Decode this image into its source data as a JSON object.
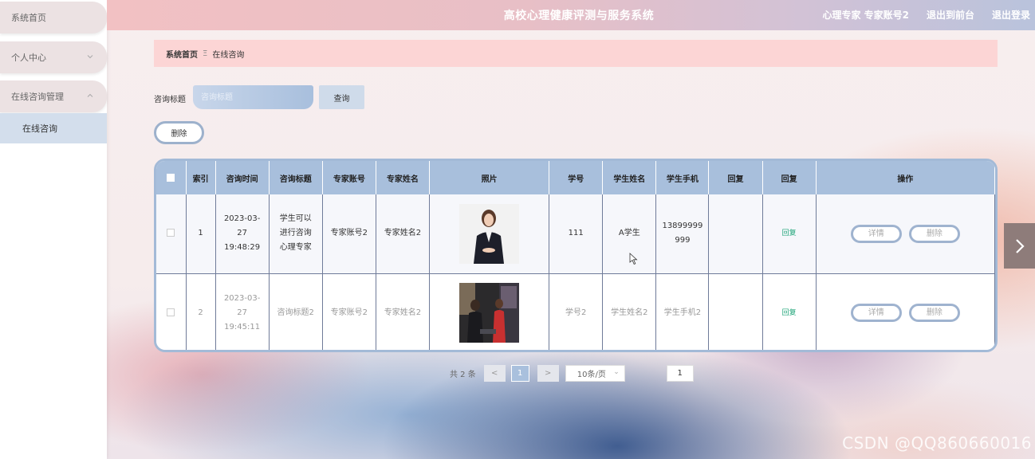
{
  "header": {
    "title": "高校心理健康评测与服务系统",
    "user": "心理专家 专家账号2",
    "back_to_front": "退出到前台",
    "logout": "退出登录"
  },
  "sidebar": {
    "items": [
      {
        "label": "系统首页"
      },
      {
        "label": "个人中心"
      },
      {
        "label": "在线咨询管理"
      }
    ],
    "sub_item": "在线咨询"
  },
  "breadcrumb": {
    "home": "系统首页",
    "separator": "Ξ",
    "current": "在线咨询"
  },
  "search": {
    "label": "咨询标题",
    "placeholder": "咨询标题",
    "button": "查询"
  },
  "actions": {
    "delete": "删除"
  },
  "table": {
    "headers": [
      "索引",
      "咨询时间",
      "咨询标题",
      "专家账号",
      "专家姓名",
      "照片",
      "学号",
      "学生姓名",
      "学生手机",
      "回复",
      "回复",
      "操作"
    ],
    "rows": [
      {
        "index": "1",
        "time": "2023-03-27 19:48:29",
        "title": "学生可以进行咨询心理专家",
        "expert_account": "专家账号2",
        "expert_name": "专家姓名2",
        "student_id": "111",
        "student_name": "A学生",
        "student_phone": "13899999999",
        "reply_text": "",
        "reply_link": "回复",
        "detail": "详情",
        "delete": "删除"
      },
      {
        "index": "2",
        "time": "2023-03-27 19:45:11",
        "title": "咨询标题2",
        "expert_account": "专家账号2",
        "expert_name": "专家姓名2",
        "student_id": "学号2",
        "student_name": "学生姓名2",
        "student_phone": "学生手机2",
        "reply_text": "",
        "reply_link": "回复",
        "detail": "详情",
        "delete": "删除"
      }
    ]
  },
  "pagination": {
    "total": "共 2 条",
    "prev": "<",
    "current_page": "1",
    "next": ">",
    "page_size": "10条/页",
    "jump_value": "1"
  },
  "watermark": "CSDN @QQ860660016",
  "colors": {
    "accent": "#a8bfdc",
    "reply_link": "#21a67a",
    "breadcrumb_bg": "#fcd5d5"
  }
}
